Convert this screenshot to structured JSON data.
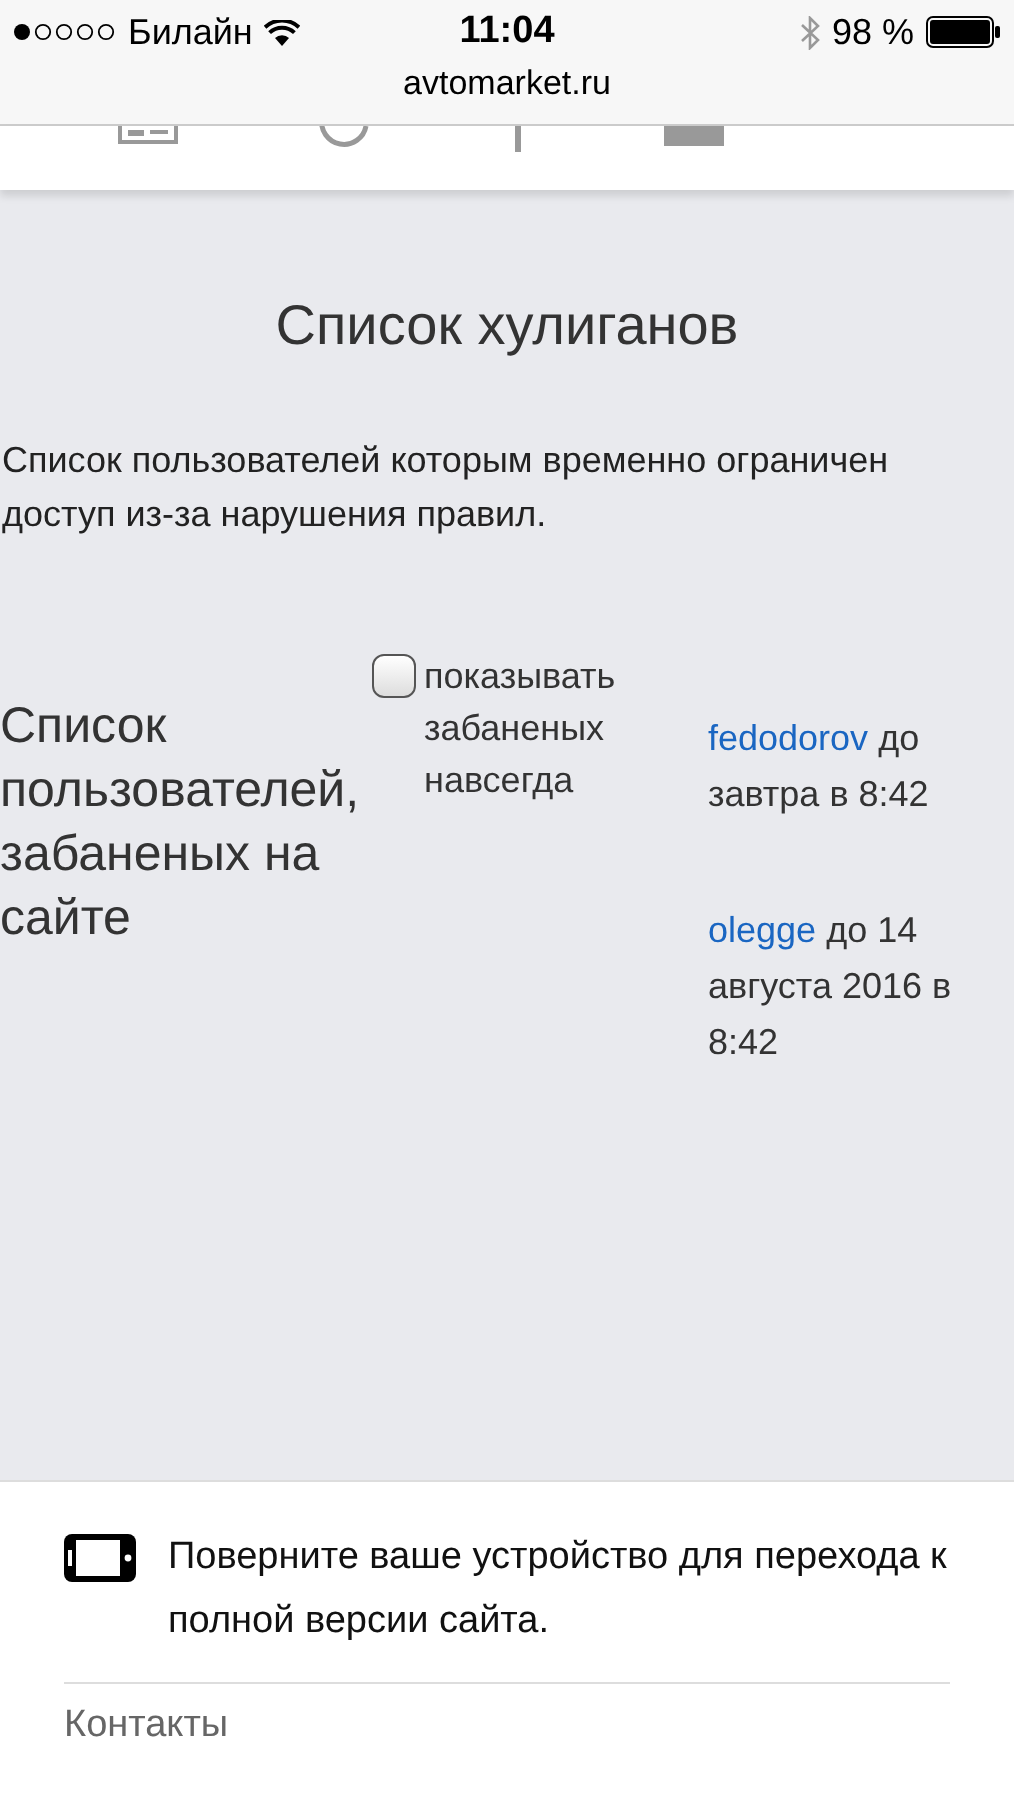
{
  "status_bar": {
    "carrier": "Билайн",
    "time": "11:04",
    "battery": "98 %"
  },
  "address_bar": {
    "url": "avtomarket.ru"
  },
  "page": {
    "title": "Список хулиганов",
    "description": "Список пользователей которым временно ограничен доступ из-за нарушения правил.",
    "list_heading": "Список пользователей, забаненых на сайте",
    "filter": {
      "label": "показывать забаненых навсегда",
      "checked": false
    },
    "bans": [
      {
        "user": "fedodorov",
        "until": "до завтра в 8:42"
      },
      {
        "user": "olegge",
        "until": "до 14 августа 2016 в 8:42"
      }
    ]
  },
  "footer": {
    "notice": "Поверните ваше устройство для перехода к полной версии сайта.",
    "links": [
      "Контакты"
    ]
  }
}
